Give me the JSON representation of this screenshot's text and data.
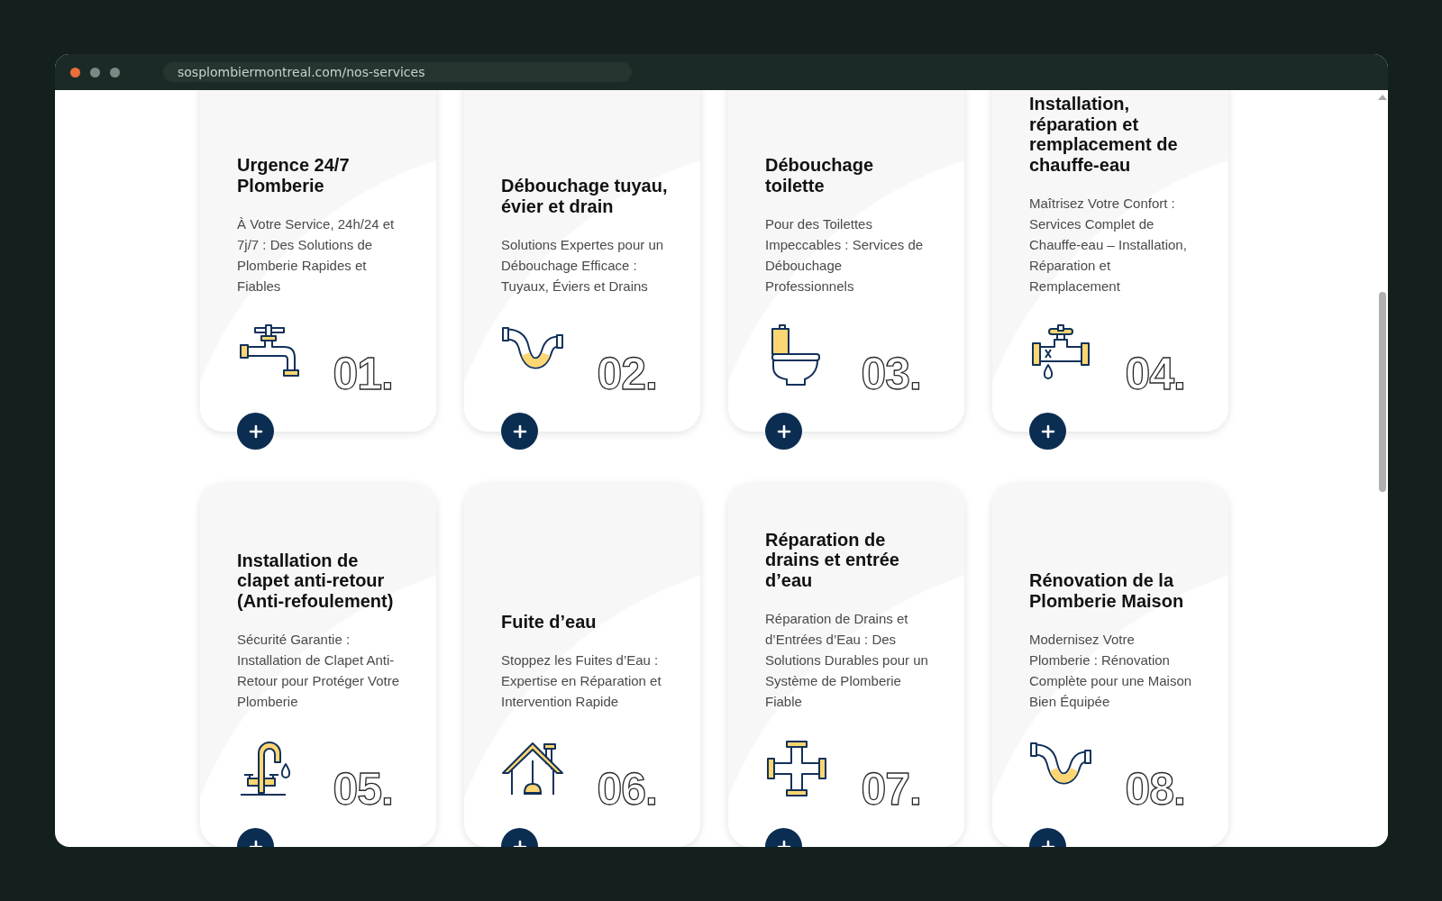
{
  "browser": {
    "url": "sosplombiermontreal.com/nos-services"
  },
  "cards": [
    {
      "title": "Urgence 24/7 Plomberie",
      "description": "À Votre Service, 24h/24 et 7j/7 : Des Solutions de Plomberie Rapides et Fiables",
      "number": "01."
    },
    {
      "title": "Débouchage tuyau, évier et drain",
      "description": "Solutions Expertes pour un Débouchage Efficace : Tuyaux, Éviers et Drains",
      "number": "02."
    },
    {
      "title": "Débouchage toilette",
      "description": "Pour des Toilettes Impeccables : Services de Débouchage Professionnels",
      "number": "03."
    },
    {
      "title": "Installation, réparation et remplacement de chauffe-eau",
      "description": "Maîtrisez Votre Confort : Services Complet de Chauffe-eau – Installation, Réparation et Remplacement",
      "number": "04."
    },
    {
      "title": "Installation de clapet anti-retour (Anti-refoulement)",
      "description": "Sécurité Garantie : Installation de Clapet Anti-Retour pour Protéger Votre Plomberie",
      "number": "05."
    },
    {
      "title": "Fuite d’eau",
      "description": "Stoppez les Fuites d’Eau : Expertise en Réparation et Intervention Rapide",
      "number": "06."
    },
    {
      "title": "Réparation de drains et entrée d’eau",
      "description": "Réparation de Drains et d’Entrées d’Eau : Des Solutions Durables pour un Système de Plomberie Fiable",
      "number": "07."
    },
    {
      "title": "Rénovation de la Plomberie Maison",
      "description": "Modernisez Votre Plomberie : Rénovation Complète pour une Maison Bien Équipée",
      "number": "08."
    }
  ]
}
